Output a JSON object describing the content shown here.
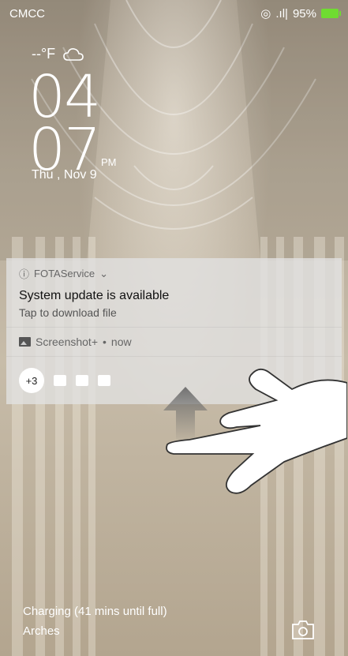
{
  "status_bar": {
    "carrier": "CMCC",
    "signal": ".ıl|",
    "battery_percent": "95%",
    "battery_color": "#6fdc31"
  },
  "weather": {
    "temperature": "--°F",
    "icon": "cloud-icon"
  },
  "clock": {
    "hour": "04",
    "minute": "07",
    "ampm": "PM",
    "date": "Thu , Nov 9"
  },
  "notifications": [
    {
      "app": "FOTAService",
      "title": "System update is available",
      "text": "Tap to download file"
    },
    {
      "app": "Screenshot+",
      "time": "now"
    }
  ],
  "more_count": "+3",
  "bottom": {
    "charging": "Charging (41 mins until full)",
    "wallpaper_name": "Arches",
    "camera_icon": "camera-icon"
  }
}
